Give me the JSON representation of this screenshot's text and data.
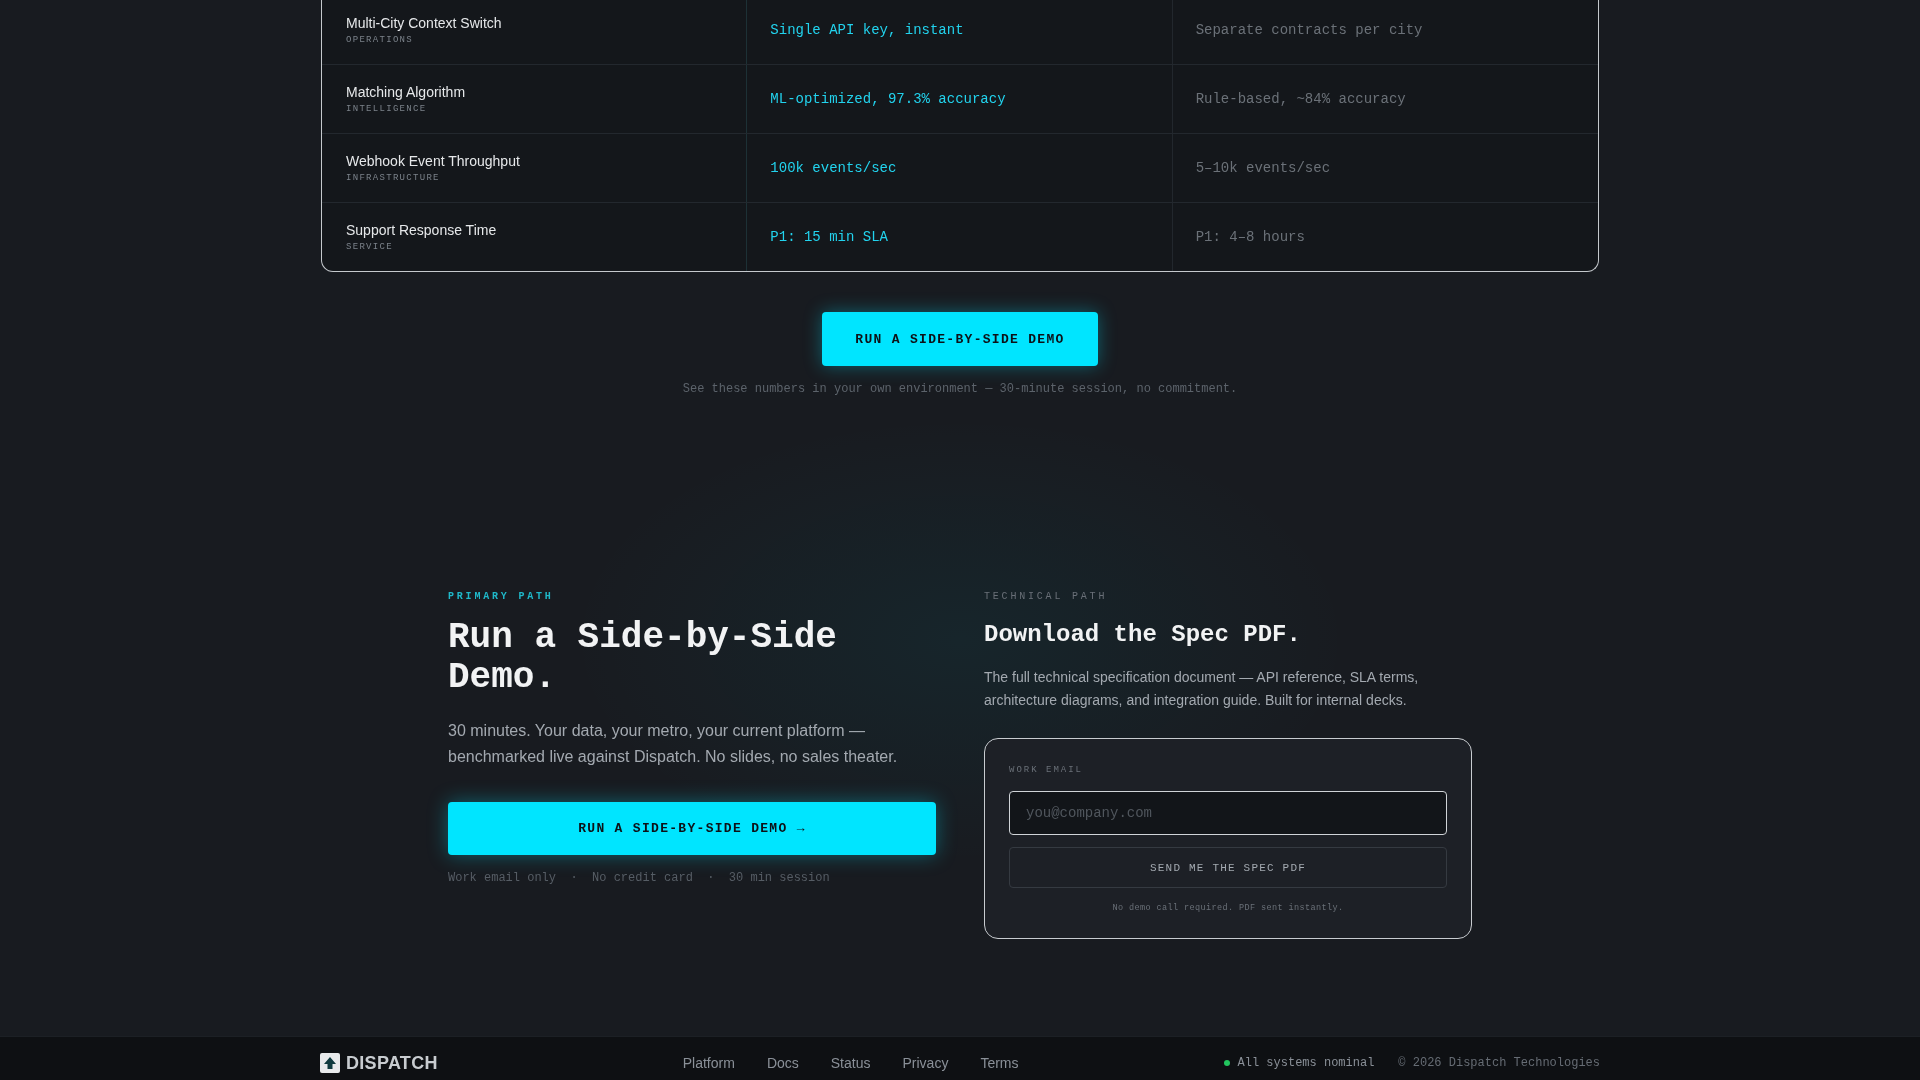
{
  "comparison_table": {
    "rows": [
      {
        "name": "Multi-City Context Switch",
        "category": "OPERATIONS",
        "column_2": "Single API key, instant",
        "column_3": "Separate contracts per city"
      },
      {
        "name": "Matching Algorithm",
        "category": "INTELLIGENCE",
        "column_2": "ML-optimized, 97.3% accuracy",
        "column_3": "Rule-based, ~84% accuracy"
      },
      {
        "name": "Webhook Event Throughput",
        "category": "INFRASTRUCTURE",
        "column_2": "100k events/sec",
        "column_3": "5–10k events/sec"
      },
      {
        "name": "Support Response Time",
        "category": "SERVICE",
        "column_2": "P1: 15 min SLA",
        "column_3": "P1: 4–8 hours"
      }
    ]
  },
  "cta": {
    "button": "RUN A SIDE-BY-SIDE DEMO",
    "note": "See these numbers in your own environment — 30-minute session, no commitment."
  },
  "paths": [
    {
      "kind": "demo",
      "eyebrow": "PRIMARY PATH",
      "title": "Run a Side-by-Side Demo.",
      "body": "30 minutes. Your data, your metro, your current platform — benchmarked live against Dispatch. No slides, no sales theater.",
      "button": "RUN A SIDE-BY-SIDE DEMO →",
      "footnote": "Work email only  ·  No credit card  ·  30 min session"
    },
    {
      "kind": "form",
      "eyebrow": "TECHNICAL PATH",
      "title": "Download the Spec PDF.",
      "body": "The full technical specification document — API reference, SLA terms, architecture diagrams, and integration guide. Built for internal decks.",
      "form": {
        "label": "WORK EMAIL",
        "placeholder": "you@company.com",
        "button": "SEND ME THE SPEC PDF",
        "note": "No demo call required. PDF sent instantly."
      }
    }
  ],
  "footer": {
    "brand": "DISPATCH",
    "links": [
      "Platform",
      "Docs",
      "Status",
      "Privacy",
      "Terms"
    ],
    "status": "All systems nominal",
    "copyright": "© 2026 Dispatch Technologies"
  }
}
